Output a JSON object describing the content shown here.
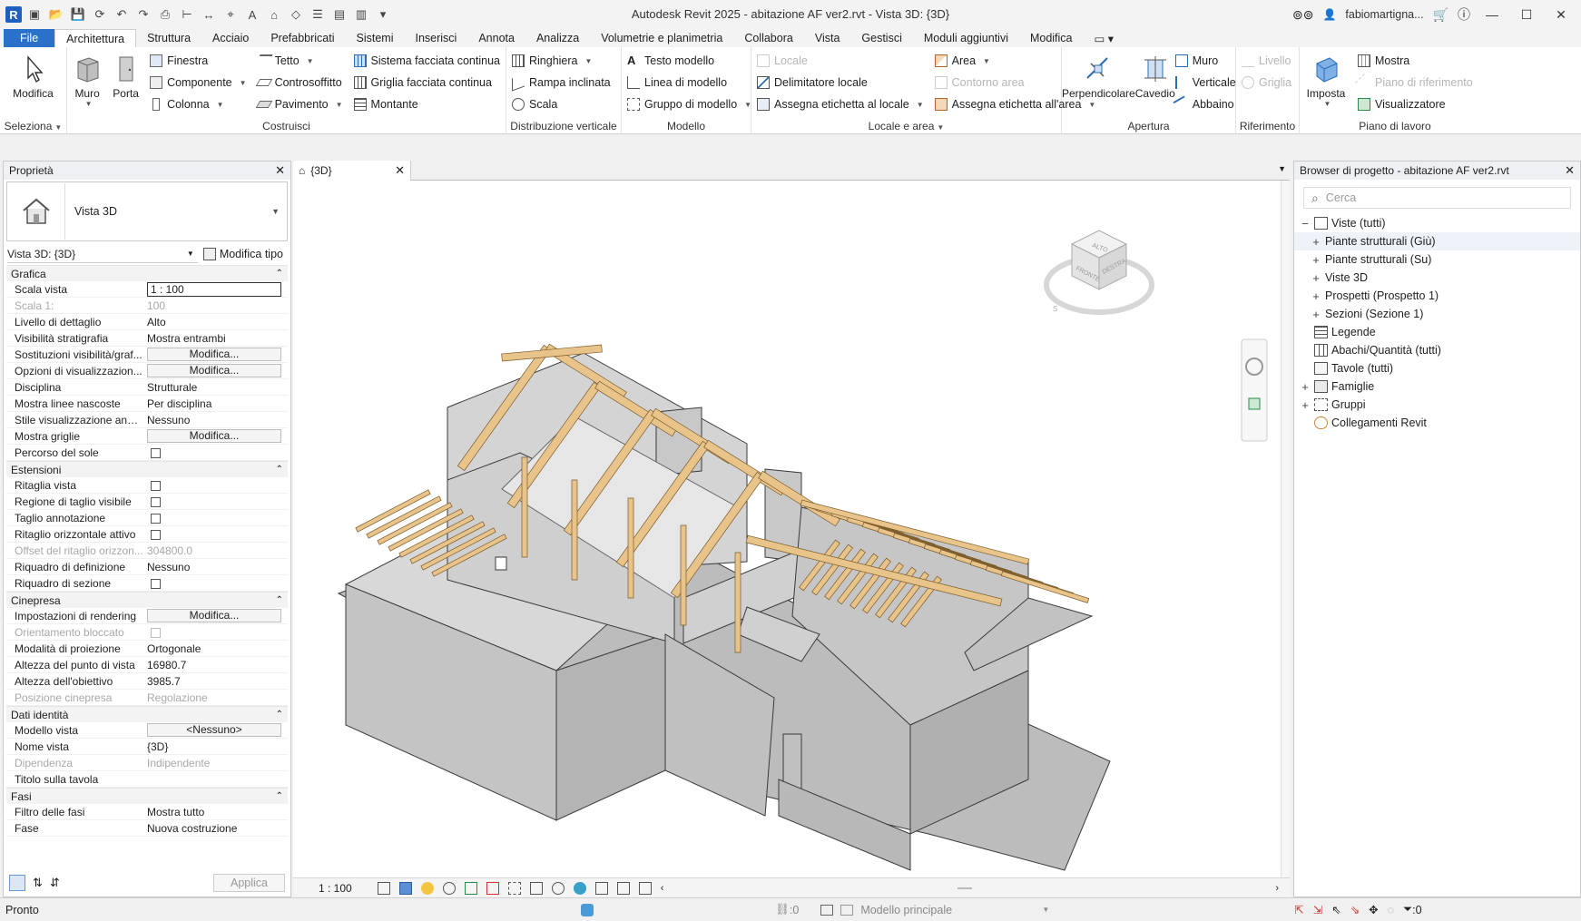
{
  "app": {
    "logo": "R",
    "title": "Autodesk Revit 2025 - abitazione AF ver2.rvt - Vista 3D: {3D}",
    "user": "fabiomartigna...",
    "icons": [
      "cart-icon",
      "help-icon",
      "minimize-icon",
      "maximize-icon",
      "close-icon"
    ]
  },
  "tabs": [
    "File",
    "Architettura",
    "Struttura",
    "Acciaio",
    "Prefabbricati",
    "Sistemi",
    "Inserisci",
    "Annota",
    "Analizza",
    "Volumetrie e planimetria",
    "Collabora",
    "Vista",
    "Gestisci",
    "Moduli aggiuntivi",
    "Modifica"
  ],
  "active_tab": "Architettura",
  "ribbon": {
    "seleziona": {
      "modify": "Modifica",
      "title": "Seleziona"
    },
    "costruisci": {
      "title": "Costruisci",
      "muro": "Muro",
      "porta": "Porta",
      "col1": [
        "Finestra",
        "Componente",
        "Colonna"
      ],
      "col2": [
        "Tetto",
        "Controsoffitto",
        "Pavimento"
      ],
      "col3": [
        "Sistema facciata continua",
        "Griglia facciata continua",
        "Montante"
      ]
    },
    "distribuzione": {
      "title": "Distribuzione verticale",
      "items": [
        "Ringhiera",
        "Rampa inclinata",
        "Scala"
      ]
    },
    "modello": {
      "title": "Modello",
      "items": [
        "Testo modello",
        "Linea di modello",
        "Gruppo di modello"
      ]
    },
    "locale": {
      "title": "Locale e area",
      "col1": [
        "Locale",
        "Delimitatore  locale",
        "Assegna etichetta  al locale"
      ],
      "col2": [
        "Area",
        "Contorno  area",
        "Assegna etichetta  all'area"
      ]
    },
    "apertura": {
      "title": "Apertura",
      "perpendicolare": "Perpendicolare",
      "cavedio": "Cavedio",
      "items": [
        "Muro",
        "Verticale",
        "Abbaino"
      ]
    },
    "riferimento": {
      "title": "Riferimento",
      "items": [
        "Livello",
        "Griglia"
      ]
    },
    "piano": {
      "title": "Piano di lavoro",
      "imposta": "Imposta",
      "items": [
        "Mostra",
        "Piano di riferimento",
        "Visualizzatore"
      ]
    }
  },
  "properties": {
    "title": "Proprietà",
    "type_name": "Vista 3D",
    "view_selector": "Vista 3D: {3D}",
    "edit_type": "Modifica tipo",
    "sections": [
      {
        "name": "Grafica",
        "rows": [
          {
            "label": "Scala vista",
            "value": "1 : 100",
            "kind": "input"
          },
          {
            "label": "Scala  1:",
            "value": "100",
            "kind": "text",
            "disabled": true
          },
          {
            "label": "Livello di dettaglio",
            "value": "Alto",
            "kind": "text"
          },
          {
            "label": "Visibilità stratigrafia",
            "value": "Mostra entrambi",
            "kind": "text"
          },
          {
            "label": "Sostituzioni visibilità/graf...",
            "value": "Modifica...",
            "kind": "button"
          },
          {
            "label": "Opzioni di visualizzazion...",
            "value": "Modifica...",
            "kind": "button"
          },
          {
            "label": "Disciplina",
            "value": "Strutturale",
            "kind": "text"
          },
          {
            "label": "Mostra linee nascoste",
            "value": "Per disciplina",
            "kind": "text"
          },
          {
            "label": "Stile visualizzazione anali...",
            "value": "Nessuno",
            "kind": "text"
          },
          {
            "label": "Mostra griglie",
            "value": "Modifica...",
            "kind": "button"
          },
          {
            "label": "Percorso del sole",
            "value": "",
            "kind": "check"
          }
        ]
      },
      {
        "name": "Estensioni",
        "rows": [
          {
            "label": "Ritaglia vista",
            "value": "",
            "kind": "check"
          },
          {
            "label": "Regione di taglio visibile",
            "value": "",
            "kind": "check"
          },
          {
            "label": "Taglio annotazione",
            "value": "",
            "kind": "check"
          },
          {
            "label": "Ritaglio orizzontale attivo",
            "value": "",
            "kind": "check"
          },
          {
            "label": "Offset del ritaglio orizzon...",
            "value": "304800.0",
            "kind": "text",
            "disabled": true
          },
          {
            "label": "Riquadro di definizione",
            "value": "Nessuno",
            "kind": "text"
          },
          {
            "label": "Riquadro di sezione",
            "value": "",
            "kind": "check"
          }
        ]
      },
      {
        "name": "Cinepresa",
        "rows": [
          {
            "label": "Impostazioni di rendering",
            "value": "Modifica...",
            "kind": "button"
          },
          {
            "label": "Orientamento bloccato",
            "value": "",
            "kind": "check",
            "disabled": true
          },
          {
            "label": "Modalità di proiezione",
            "value": "Ortogonale",
            "kind": "text"
          },
          {
            "label": "Altezza del punto di vista",
            "value": "16980.7",
            "kind": "text"
          },
          {
            "label": "Altezza dell'obiettivo",
            "value": "3985.7",
            "kind": "text"
          },
          {
            "label": "Posizione cinepresa",
            "value": "Regolazione",
            "kind": "text",
            "disabled": true
          }
        ]
      },
      {
        "name": "Dati identità",
        "rows": [
          {
            "label": "Modello vista",
            "value": "<Nessuno>",
            "kind": "button"
          },
          {
            "label": "Nome vista",
            "value": "{3D}",
            "kind": "text"
          },
          {
            "label": "Dipendenza",
            "value": "Indipendente",
            "kind": "text",
            "disabled": true
          },
          {
            "label": "Titolo sulla tavola",
            "value": "",
            "kind": "text"
          }
        ]
      },
      {
        "name": "Fasi",
        "rows": [
          {
            "label": "Filtro delle fasi",
            "value": "Mostra tutto",
            "kind": "text"
          },
          {
            "label": "Fase",
            "value": "Nuova costruzione",
            "kind": "text"
          }
        ]
      }
    ],
    "apply": "Applica"
  },
  "view": {
    "tab_label": "{3D}",
    "scale": "1 : 100",
    "viewcube_faces": [
      "ALTO",
      "FRONTE",
      "DESTRA"
    ],
    "compass": "S"
  },
  "browser": {
    "title": "Browser di progetto - abitazione AF ver2.rvt",
    "search_placeholder": "Cerca",
    "nodes": [
      {
        "label": "Viste (tutti)",
        "level": 0,
        "exp": "−",
        "icon": "views-icon"
      },
      {
        "label": "Piante strutturali (Giù)",
        "level": 1,
        "exp": "+",
        "selected": true
      },
      {
        "label": "Piante strutturali (Su)",
        "level": 1,
        "exp": "+"
      },
      {
        "label": "Viste 3D",
        "level": 1,
        "exp": "+"
      },
      {
        "label": "Prospetti (Prospetto 1)",
        "level": 1,
        "exp": "+"
      },
      {
        "label": "Sezioni (Sezione 1)",
        "level": 1,
        "exp": "+"
      },
      {
        "label": "Legende",
        "level": 0,
        "exp": "",
        "icon": "legend-icon"
      },
      {
        "label": "Abachi/Quantità (tutti)",
        "level": 0,
        "exp": "",
        "icon": "schedule-icon"
      },
      {
        "label": "Tavole (tutti)",
        "level": 0,
        "exp": "",
        "icon": "sheet-icon"
      },
      {
        "label": "Famiglie",
        "level": 0,
        "exp": "+",
        "icon": "family-icon"
      },
      {
        "label": "Gruppi",
        "level": 0,
        "exp": "+",
        "icon": "group-icon"
      },
      {
        "label": "Collegamenti Revit",
        "level": 0,
        "exp": "",
        "icon": "link-icon"
      }
    ]
  },
  "status": {
    "text": "Pronto",
    "worksets": ":0",
    "model": "Modello principale",
    "filter": ":0"
  },
  "colors": {
    "accent": "#2a72c9",
    "wall": "#c4c4c4",
    "beam": "#e9c48a"
  }
}
